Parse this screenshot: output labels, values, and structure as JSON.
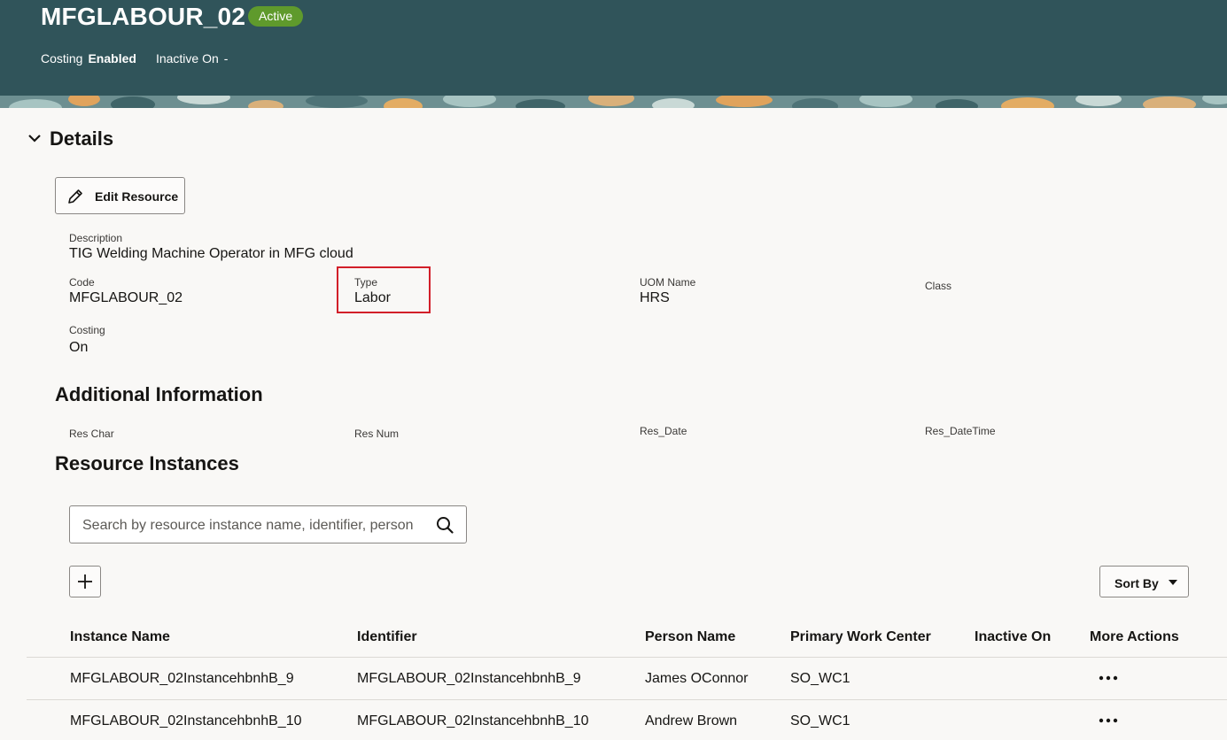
{
  "header": {
    "title": "MFGLABOUR_02",
    "status_badge": "Active",
    "costing_label": "Costing",
    "costing_value": "Enabled",
    "inactive_label": "Inactive On",
    "inactive_value": "-",
    "color": "#30545a",
    "badge_color": "#5f9a2c"
  },
  "details": {
    "section_title": "Details",
    "edit_button_label": "Edit Resource",
    "description_label": "Description",
    "description_value": "TIG Welding Machine Operator in MFG cloud",
    "code_label": "Code",
    "code_value": "MFGLABOUR_02",
    "type_label": "Type",
    "type_value": "Labor",
    "uom_label": "UOM Name",
    "uom_value": "HRS",
    "class_label": "Class",
    "costing_label": "Costing",
    "costing_value": "On",
    "highlight_color": "#d21f29"
  },
  "additional": {
    "title": "Additional Information",
    "res_char_label": "Res  Char",
    "res_num_label": "Res  Num",
    "res_date_label": "Res_Date",
    "res_datetime_label": "Res_DateTime"
  },
  "instances": {
    "title": "Resource Instances",
    "search_placeholder": "Search by resource instance name, identifier, person",
    "sort_label": "Sort By",
    "columns": [
      "Instance Name",
      "Identifier",
      "Person Name",
      "Primary Work Center",
      "Inactive On",
      "More Actions"
    ],
    "rows": [
      {
        "instance_name": "MFGLABOUR_02InstancehbnhB_9",
        "identifier": "MFGLABOUR_02InstancehbnhB_9",
        "person_name": "James OConnor",
        "work_center": "SO_WC1",
        "inactive_on": ""
      },
      {
        "instance_name": "MFGLABOUR_02InstancehbnhB_10",
        "identifier": "MFGLABOUR_02InstancehbnhB_10",
        "person_name": "Andrew Brown",
        "work_center": "SO_WC1",
        "inactive_on": ""
      }
    ]
  }
}
